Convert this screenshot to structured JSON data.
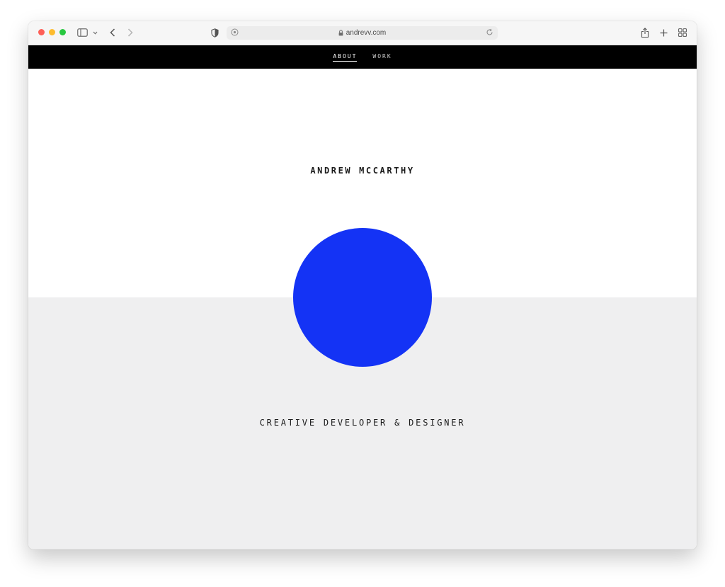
{
  "browser": {
    "url": "andrevv.com",
    "icons": {
      "sidebar": "sidebar-icon",
      "sidebar_menu": "chevron-down-icon",
      "back": "chevron-left-icon",
      "forward": "chevron-right-icon",
      "privacy": "shield-icon",
      "page_settings": "page-settings-icon",
      "lock": "lock-icon",
      "reload": "reload-icon",
      "share": "share-icon",
      "new_tab": "plus-icon",
      "tab_overview": "grid-icon"
    }
  },
  "nav": {
    "items": [
      {
        "label": "ABOUT",
        "active": true
      },
      {
        "label": "WORK",
        "active": false
      }
    ]
  },
  "hero": {
    "name": "ANDREW MCCARTHY",
    "tagline": "CREATIVE DEVELOPER & DESIGNER"
  },
  "colors": {
    "nav_background": "#000000",
    "accent_circle": "#1433f5",
    "lower_background": "#efeff0",
    "upper_background": "#ffffff"
  }
}
